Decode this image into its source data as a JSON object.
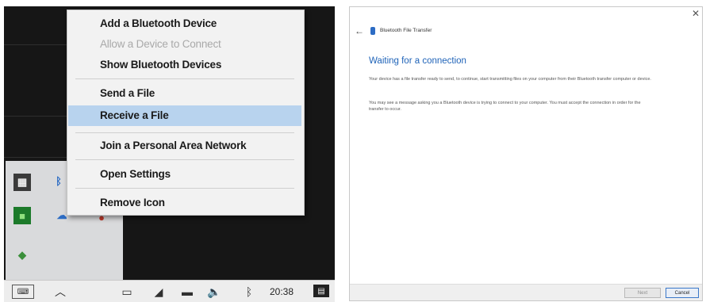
{
  "context_menu": {
    "items": [
      {
        "label": "Add a Bluetooth Device",
        "state": "enabled"
      },
      {
        "label": "Allow a Device to Connect",
        "state": "disabled"
      },
      {
        "label": "Show Bluetooth Devices",
        "state": "enabled"
      },
      {
        "label": "Send a File",
        "state": "enabled"
      },
      {
        "label": "Receive a File",
        "state": "selected"
      },
      {
        "label": "Join a Personal Area Network",
        "state": "enabled"
      },
      {
        "label": "Open Settings",
        "state": "enabled"
      },
      {
        "label": "Remove Icon",
        "state": "enabled"
      }
    ]
  },
  "taskbar": {
    "time": "20:38",
    "tray_icons": [
      "keyboard-icon",
      "chevron-up-icon",
      "display-icon",
      "network-icon",
      "battery-icon",
      "volume-icon",
      "bluetooth-icon",
      "notification-icon"
    ]
  },
  "tray_overflow_icons": [
    "app-icon",
    "bluetooth-icon",
    "nvidia-icon",
    "onedrive-icon",
    "antivirus-icon",
    "update-icon"
  ],
  "dialog": {
    "window_title": "Bluetooth File Transfer",
    "heading": "Waiting for a connection",
    "paragraph_1": "Your device has a file transfer ready to send, to continue, start transmitting files on your computer from their Bluetooth transfer computer or device.",
    "paragraph_2": "You may see a message asking you a Bluetooth device is trying to connect to your computer. You must accept the connection in order for the transfer to occur.",
    "next_button": "Next",
    "cancel_button": "Cancel"
  },
  "colors": {
    "selection": "#b8d3ee",
    "heading_blue": "#1f63b8",
    "desktop_bg": "#161616"
  }
}
